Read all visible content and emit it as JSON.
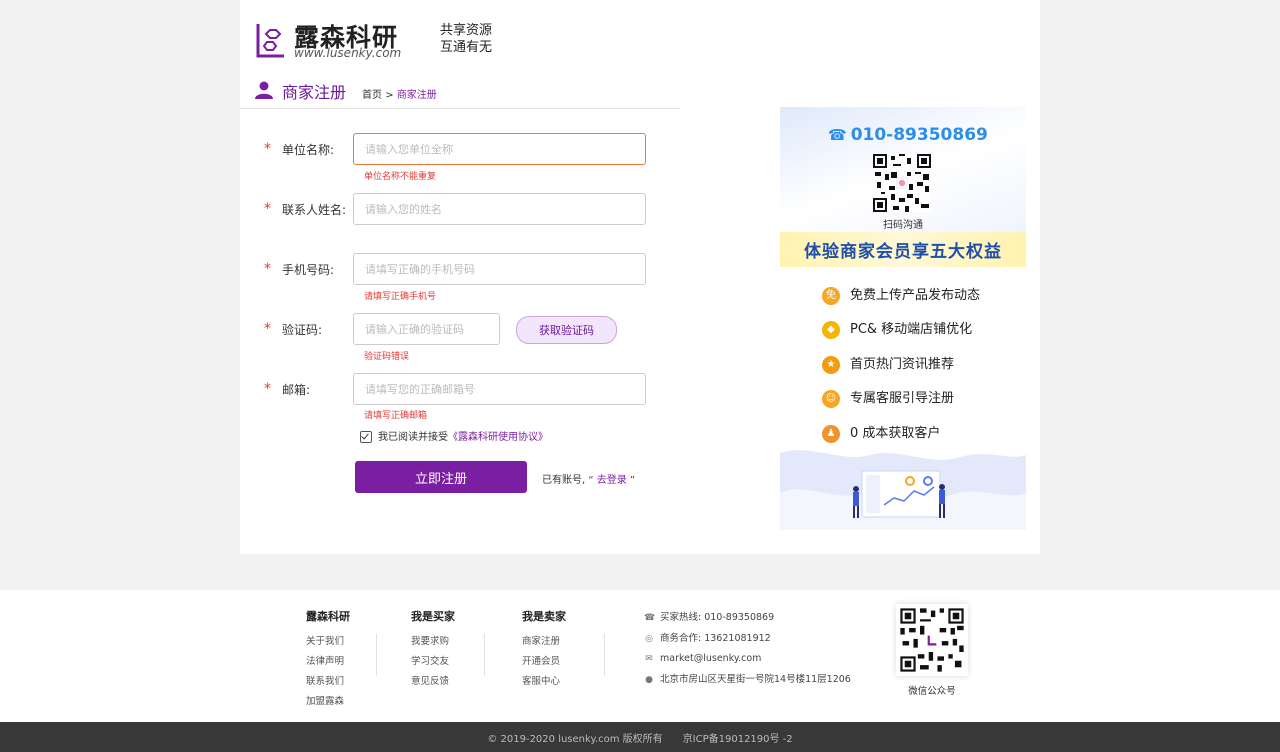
{
  "brand": {
    "name": "露森科研",
    "url": "www.lusenky.com",
    "slogan_line1": "共享资源",
    "slogan_line2": "互通有无"
  },
  "page": {
    "title": "商家注册",
    "breadcrumb_home": "首页",
    "breadcrumb_sep": ">",
    "breadcrumb_current": "商家注册"
  },
  "form": {
    "required_mark": "*",
    "company": {
      "label": "单位名称:",
      "placeholder": "请输入您单位全称",
      "value": "",
      "error": "单位名称不能重复"
    },
    "contact": {
      "label": "联系人姓名:",
      "placeholder": "请输入您的姓名",
      "value": ""
    },
    "phone": {
      "label": "手机号码:",
      "placeholder": "请填写正确的手机号码",
      "value": "",
      "error": "请填写正确手机号"
    },
    "code": {
      "label": "验证码:",
      "placeholder": "请输入正确的验证码",
      "value": "",
      "error": "验证码错误",
      "button": "获取验证码"
    },
    "email": {
      "label": "邮箱:",
      "placeholder": "请填写您的正确邮箱号",
      "value": "",
      "error": "请填写正确邮箱"
    },
    "agree_text": "我已阅读并接受",
    "agree_link": "《露森科研使用协议》",
    "submit": "立即注册",
    "login_prompt": "已有账号,",
    "login_link": "“ 去登录 ”"
  },
  "banner": {
    "phone": "010-89350869",
    "scan_text": "扫码沟通",
    "promo": "体验商家会员享五大权益",
    "benefits": [
      {
        "text": "免费上传产品发布动态",
        "icon": "free-badge-icon",
        "glyph": "免",
        "color": "#f5a623"
      },
      {
        "text": "PC& 移动端店铺优化",
        "icon": "diamond-icon",
        "glyph": "◆",
        "color": "#f7b500"
      },
      {
        "text": "首页热门资讯推荐",
        "icon": "medal-icon",
        "glyph": "★",
        "color": "#f39c12"
      },
      {
        "text": "专属客服引导注册",
        "icon": "chat-icon",
        "glyph": "☺",
        "color": "#f5a623"
      },
      {
        "text": "0 成本获取客户",
        "icon": "customers-icon",
        "glyph": "♟",
        "color": "#f0932b"
      }
    ]
  },
  "footer": {
    "col1": {
      "title": "露森科研",
      "items": [
        "关于我们",
        "法律声明",
        "联系我们",
        "加盟露森"
      ]
    },
    "col2": {
      "title": "我是买家",
      "items": [
        "我要求购",
        "学习交友",
        "意见反馈"
      ]
    },
    "col3": {
      "title": "我是卖家",
      "items": [
        "商家注册",
        "开通会员",
        "客服中心"
      ]
    },
    "contact": {
      "buyer_hotline": "买家热线: 010-89350869",
      "business": "商务合作: 13621081912",
      "email": "market@lusenky.com",
      "address": "北京市房山区天星街一号院14号楼11层1206"
    },
    "qr_label": "微信公众号"
  },
  "copyright": {
    "text": "© 2019-2020 lusenky.com 版权所有",
    "icp": "京ICP备19012190号 -2"
  },
  "colors": {
    "accent": "#7b1fa2",
    "error": "#e53935",
    "phone_blue": "#2b8fe8"
  }
}
